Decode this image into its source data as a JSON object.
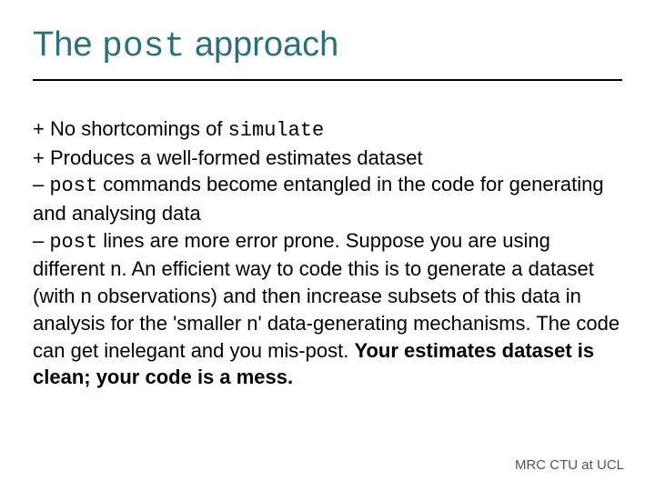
{
  "title": {
    "pre": "The ",
    "code": "post",
    "post": " approach"
  },
  "body": {
    "line1_pre": "+ No shortcomings of ",
    "line1_code": "simulate",
    "line2": "+ Produces a well-formed estimates dataset",
    "line3_pre": "– ",
    "line3_code": "post",
    "line3_post": "  commands become entangled in the code for generating and analysing data",
    "line4_pre": "– ",
    "line4_code": "post",
    "line4_post": " lines are more error prone. Suppose you are using different n. An efficient way to code this is to generate a dataset (with n observations) and then increase subsets of this data in analysis for the 'smaller n' data-generating mechanisms. The code can get inelegant and you mis-post.",
    "line5_bold": "Your estimates dataset is clean; your code is a mess."
  },
  "footer": "MRC CTU at UCL"
}
